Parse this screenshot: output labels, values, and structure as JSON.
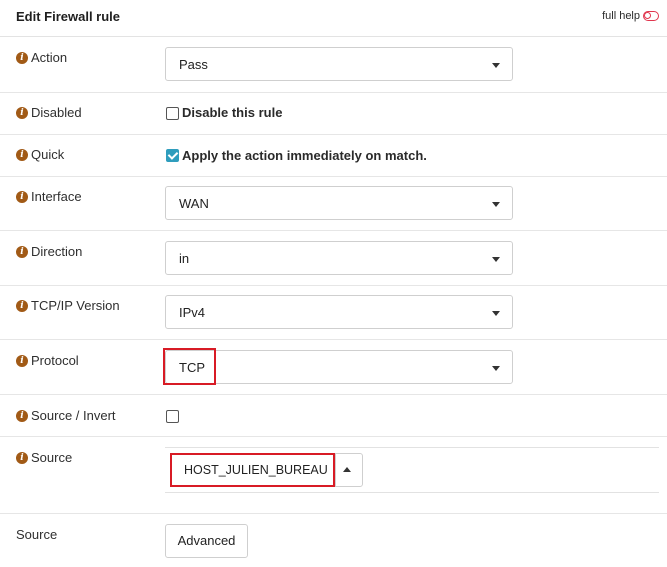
{
  "panel": {
    "title": "Edit Firewall rule",
    "full_help": "full help"
  },
  "fields": {
    "action": {
      "label": "Action",
      "value": "Pass"
    },
    "disabled": {
      "label": "Disabled",
      "checkbox_label": "Disable this rule",
      "checked": false
    },
    "quick": {
      "label": "Quick",
      "checkbox_label": "Apply the action immediately on match.",
      "checked": true
    },
    "interface": {
      "label": "Interface",
      "value": "WAN"
    },
    "direction": {
      "label": "Direction",
      "value": "in"
    },
    "tcpip_version": {
      "label": "TCP/IP Version",
      "value": "IPv4"
    },
    "protocol": {
      "label": "Protocol",
      "value": "TCP"
    },
    "source_invert": {
      "label": "Source / Invert",
      "checked": false
    },
    "source": {
      "label": "Source",
      "value": "HOST_JULIEN_BUREAU"
    },
    "source_advanced": {
      "label": "Source",
      "button_label": "Advanced"
    }
  },
  "colors": {
    "info_icon": "#a15a16",
    "checkbox_checked": "#2f9dbd",
    "highlight_box": "#d81b25",
    "toggle_icon": "#e0364e"
  },
  "icons": {
    "info": "info-circle-icon",
    "dropdown": "caret-down-icon",
    "expand": "caret-up-icon",
    "help_toggle": "toggle-off-icon"
  }
}
